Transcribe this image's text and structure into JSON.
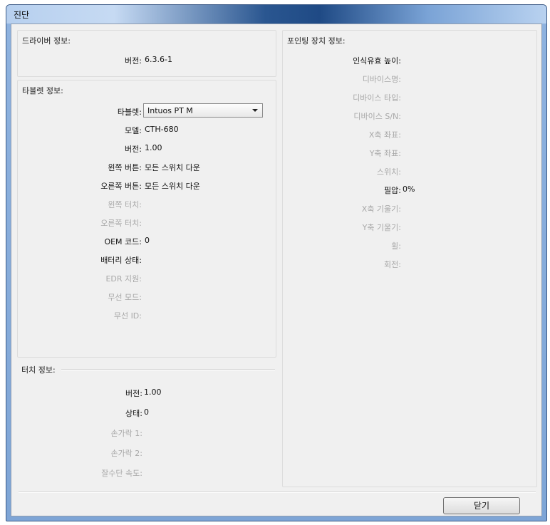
{
  "window": {
    "title": "진단"
  },
  "driver_info": {
    "title": "드라이버 정보:",
    "version_label": "버전:",
    "version_value": "6.3.6-1"
  },
  "tablet_info": {
    "title": "타블렛 정보:",
    "tablet_label": "타블렛:",
    "tablet_selected": "Intuos PT M",
    "model_label": "모델:",
    "model_value": "CTH-680",
    "version_label": "버전:",
    "version_value": "1.00",
    "left_buttons_label": "왼쪽 버튼:",
    "left_buttons_value": "모든 스위치 다운",
    "right_buttons_label": "오른쪽 버튼:",
    "right_buttons_value": "모든 스위치 다운",
    "left_touch_label": "왼쪽 터치:",
    "right_touch_label": "오른쪽 터치:",
    "oem_label": "OEM 코드:",
    "oem_value": "0",
    "battery_label": "배터리 상태:",
    "edr_label": "EDR 지원:",
    "wireless_mode_label": "무선 모드:",
    "wireless_id_label": "무선 ID:"
  },
  "touch_info": {
    "title": "터치 정보:",
    "version_label": "버전:",
    "version_value": "1.00",
    "status_label": "상태:",
    "status_value": "0",
    "finger1_label": "손가락 1:",
    "finger2_label": "손가락 2:",
    "distance_label": "잘수단 속도:"
  },
  "pointing_info": {
    "title": "포인팅 장치 정보:",
    "height_label": "인식유효 높이:",
    "device_name_label": "디바이스명:",
    "device_type_label": "디바이스 타입:",
    "device_serial_label": "디바이스 S/N:",
    "x_label": "X축 좌표:",
    "y_label": "Y축 좌표:",
    "switch_label": "스위치:",
    "pressure_label": "필압:",
    "pressure_value": "0%",
    "x_tilt_label": "X축 기울기:",
    "y_tilt_label": "Y축 기울기:",
    "wheel_label": "휠:",
    "rotation_label": "회전:"
  },
  "buttons": {
    "close": "닫기"
  }
}
